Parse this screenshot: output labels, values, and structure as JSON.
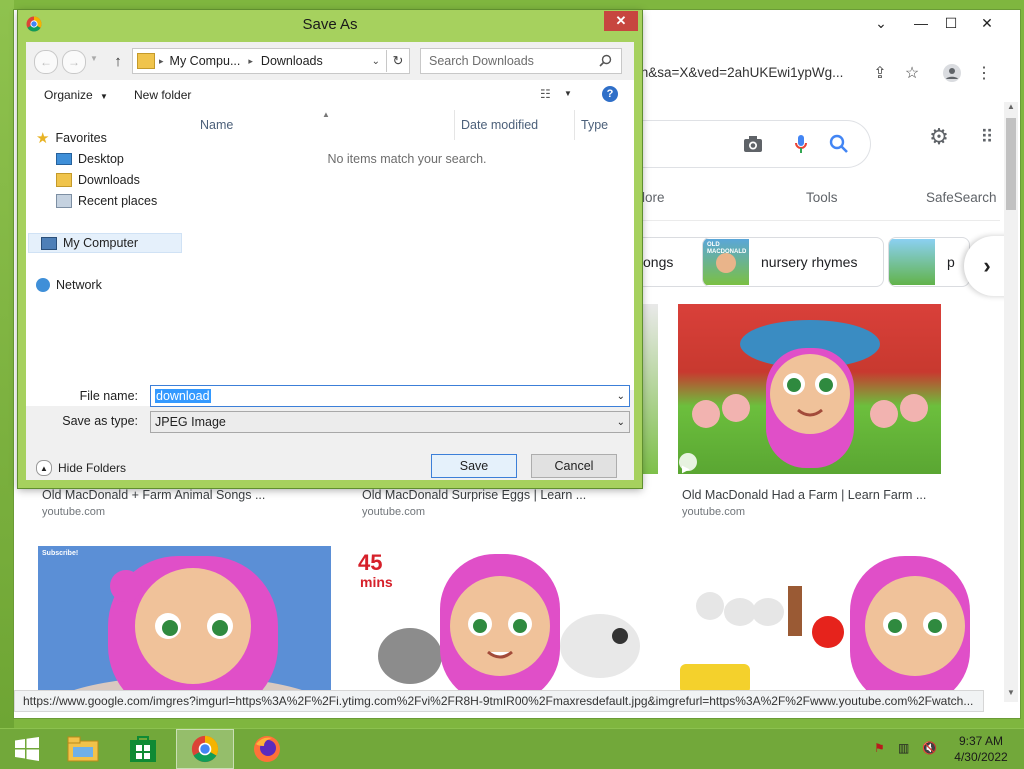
{
  "browser": {
    "address_fragment": "ch&sa=X&ved=2ahUKEwi1ypWg...",
    "tabs": [
      "lore",
      "Tools",
      "SafeSearch"
    ],
    "chips": [
      "songs",
      "nursery rhymes",
      "p"
    ],
    "chip_thumb_text": "OLD MACDONALD",
    "results_row1": [
      {
        "title": "Old MacDonald + Farm Animal Songs ...",
        "source": "youtube.com"
      },
      {
        "title": "Old MacDonald Surprise Eggs | Learn ...",
        "source": "youtube.com"
      },
      {
        "title": "Old MacDonald Had a Farm | Learn Farm ...",
        "source": "youtube.com"
      }
    ],
    "thumb_badge_45": "45",
    "thumb_badge_mins": "mins",
    "thumb_badge_subscribe": "Subscribe!",
    "status_url": "https://www.google.com/imgres?imgurl=https%3A%2F%2Fi.ytimg.com%2Fvi%2FR8H-9tmIR00%2Fmaxresdefault.jpg&imgrefurl=https%3A%2F%2Fwww.youtube.com%2Fwatch..."
  },
  "dialog": {
    "title": "Save As",
    "path": [
      "My Compu...",
      "Downloads"
    ],
    "search_placeholder": "Search Downloads",
    "organize": "Organize",
    "new_folder": "New folder",
    "nav": {
      "favorites": "Favorites",
      "desktop": "Desktop",
      "downloads": "Downloads",
      "recent": "Recent places",
      "computer": "My Computer",
      "network": "Network"
    },
    "columns": {
      "name": "Name",
      "date": "Date modified",
      "type": "Type"
    },
    "empty_message": "No items match your search.",
    "file_name_label": "File name:",
    "file_name_value": "download",
    "save_type_label": "Save as type:",
    "save_type_value": "JPEG Image",
    "hide_folders": "Hide Folders",
    "save": "Save",
    "cancel": "Cancel"
  },
  "taskbar": {
    "time": "9:37 AM",
    "date": "4/30/2022"
  },
  "colors": {
    "desktop": "#7fb63f",
    "dialog_frame": "#a6d15e",
    "close_red": "#c7463f",
    "google_blue": "#4285f4",
    "selection": "#3399ff"
  }
}
